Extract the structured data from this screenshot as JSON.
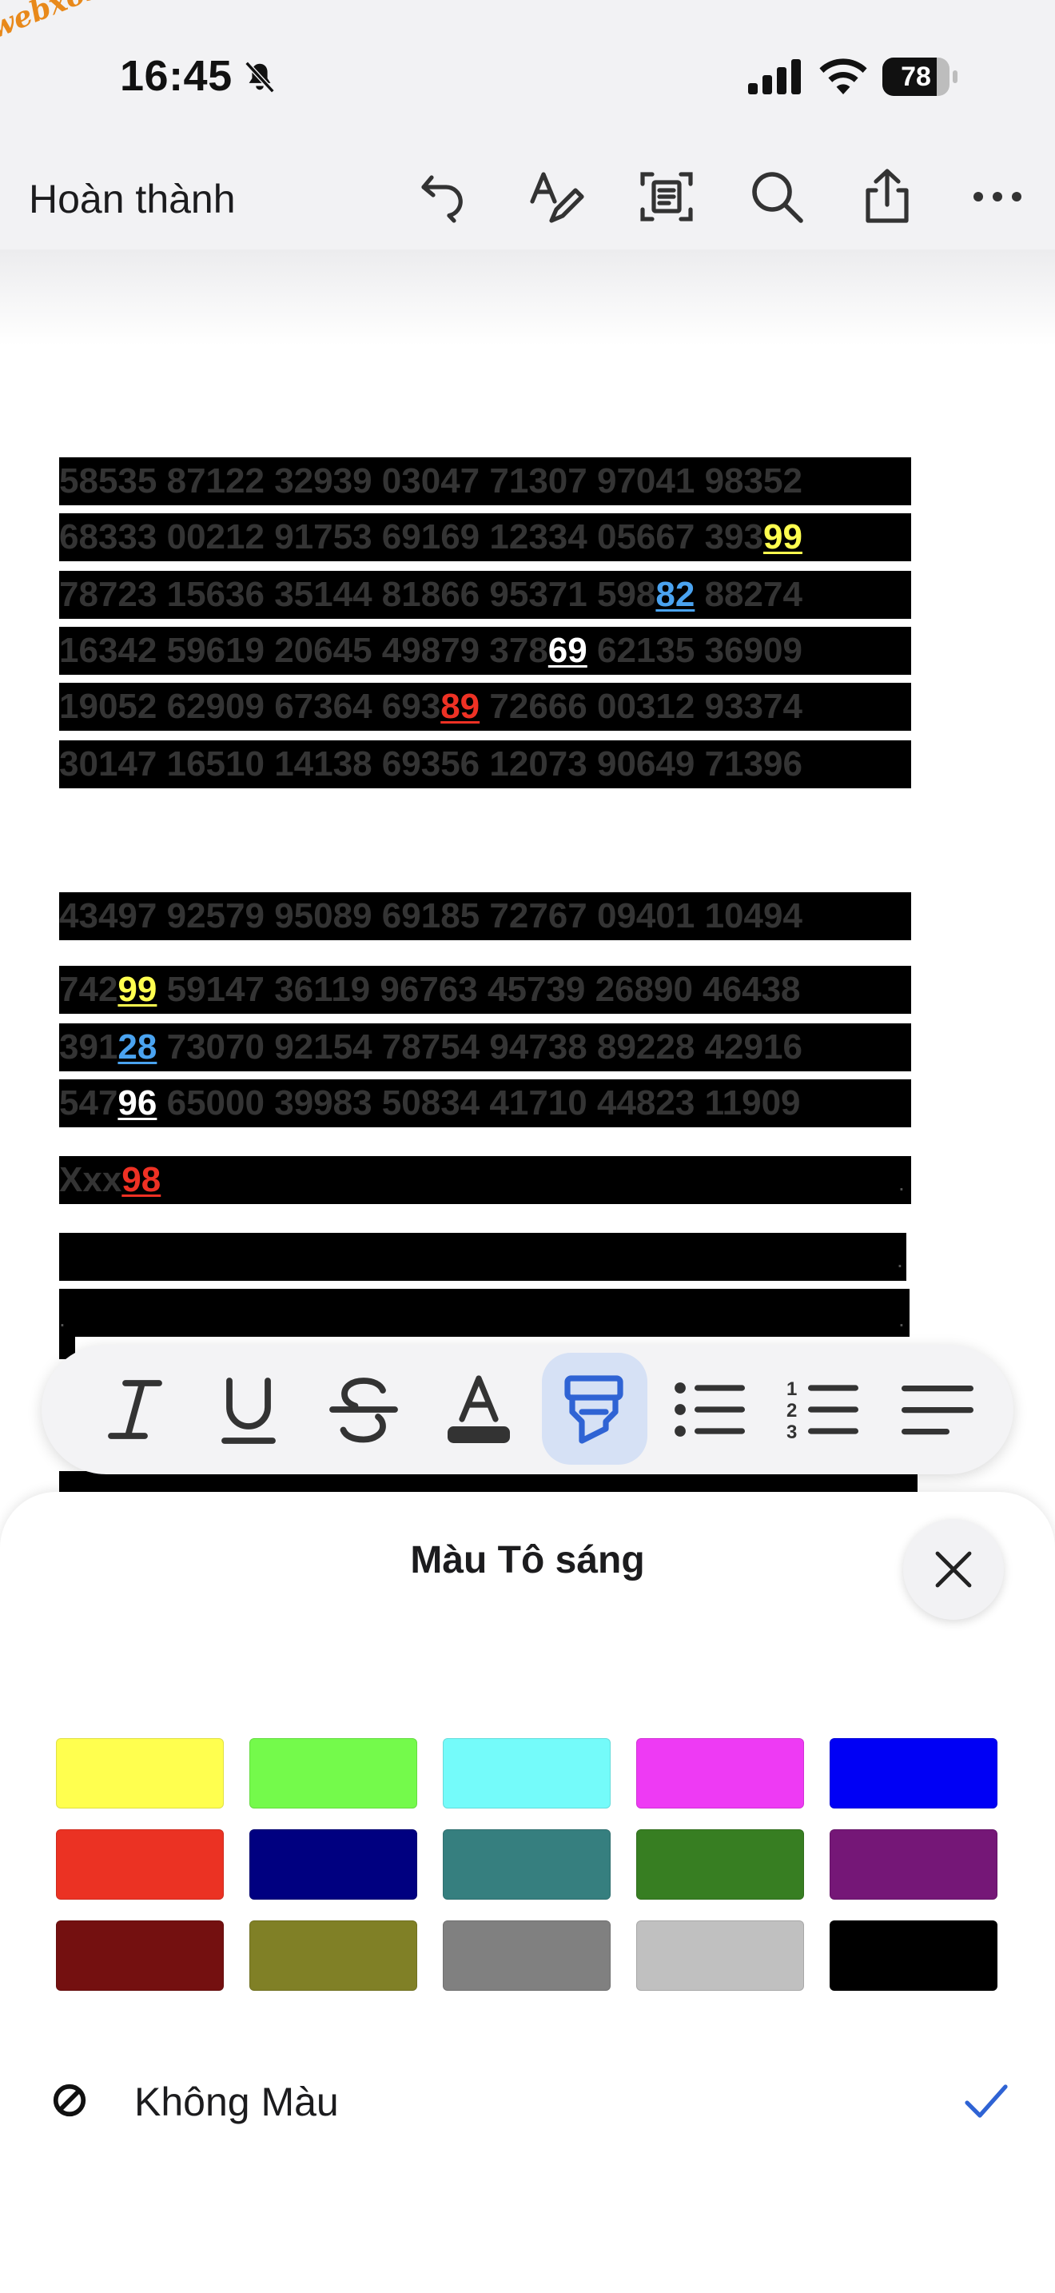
{
  "watermark": "webxoso.net",
  "status": {
    "time": "16:45",
    "battery": "78"
  },
  "nav": {
    "done_label": "Hoàn thành"
  },
  "document": {
    "block1": [
      [
        "58535",
        "87122",
        "32939",
        "03047",
        "71307",
        "97041",
        "98352"
      ],
      [
        "68333",
        "00212",
        "91753",
        "69169",
        "12334",
        "05667",
        "393",
        "99"
      ],
      [
        "78723",
        "15636",
        "35144",
        "81866",
        "95371",
        "598",
        "82",
        "88274"
      ],
      [
        "16342",
        "59619",
        "20645",
        "49879",
        "378",
        "69",
        "62135",
        "36909"
      ],
      [
        "19052",
        "62909",
        "67364",
        "693",
        "89",
        "72666",
        "00312",
        "93374"
      ],
      [
        "30147",
        "16510",
        "14138",
        "69356",
        "12073",
        "90649",
        "71396"
      ]
    ],
    "block2": [
      [
        "43497",
        "92579",
        "95089",
        "69185",
        "72767",
        "09401",
        "10494"
      ],
      [
        "742",
        "99",
        "59147",
        "36119",
        "96763",
        "45739",
        "26890",
        "46438"
      ],
      [
        "391",
        "28",
        "73070",
        "92154",
        "78754",
        "94738",
        "89228",
        "42916"
      ],
      [
        "547",
        "96",
        "65000",
        "39983",
        "50834",
        "41710",
        "44823",
        "11909"
      ]
    ],
    "xxx_prefix": "Xxx",
    "xxx_value": "98",
    "dot": "."
  },
  "highlight_colors": {
    "yellow": "#ffff4f",
    "blue": "#4aa3f0",
    "white": "#ffffff",
    "red": "#ee3124"
  },
  "sheet": {
    "title": "Màu Tô sáng",
    "swatches": [
      "#ffff4f",
      "#74fa4b",
      "#74fbfa",
      "#ee3af4",
      "#0000f5",
      "#eb3223",
      "#000080",
      "#367f7f",
      "#377e22",
      "#751777",
      "#741010",
      "#808026",
      "#808080",
      "#c0c0c0",
      "#000000"
    ],
    "no_color_label": "Không Màu"
  }
}
